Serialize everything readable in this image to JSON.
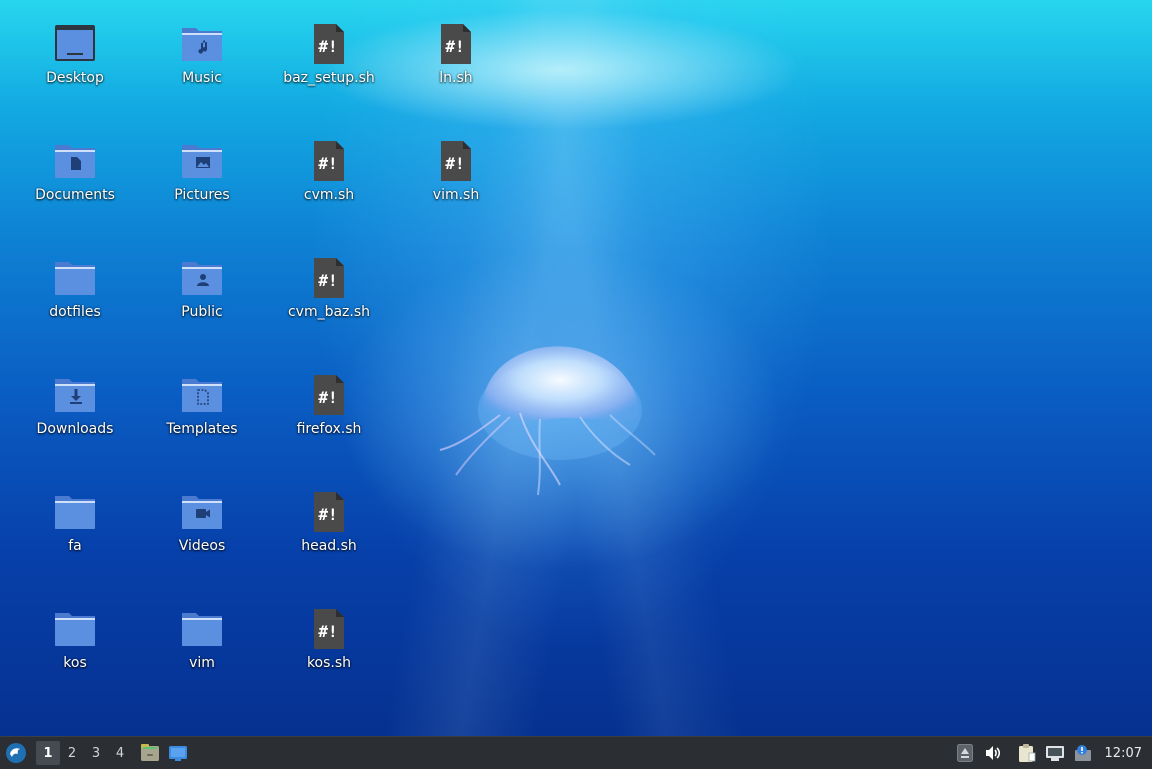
{
  "desktop": {
    "icons": [
      {
        "label": "Desktop",
        "icon": "desktop-folder-icon"
      },
      {
        "label": "Music",
        "icon": "music-folder-icon"
      },
      {
        "label": "baz_setup.sh",
        "icon": "shell-script-icon"
      },
      {
        "label": "ln.sh",
        "icon": "shell-script-icon"
      },
      {
        "label": "Documents",
        "icon": "documents-folder-icon"
      },
      {
        "label": "Pictures",
        "icon": "pictures-folder-icon"
      },
      {
        "label": "cvm.sh",
        "icon": "shell-script-icon"
      },
      {
        "label": "vim.sh",
        "icon": "shell-script-icon"
      },
      {
        "label": "dotfiles",
        "icon": "folder-icon"
      },
      {
        "label": "Public",
        "icon": "public-folder-icon"
      },
      {
        "label": "cvm_baz.sh",
        "icon": "shell-script-icon"
      },
      {
        "label": "Downloads",
        "icon": "downloads-folder-icon"
      },
      {
        "label": "Templates",
        "icon": "templates-folder-icon"
      },
      {
        "label": "firefox.sh",
        "icon": "shell-script-icon"
      },
      {
        "label": "fa",
        "icon": "folder-icon"
      },
      {
        "label": "Videos",
        "icon": "videos-folder-icon"
      },
      {
        "label": "head.sh",
        "icon": "shell-script-icon"
      },
      {
        "label": "kos",
        "icon": "folder-icon"
      },
      {
        "label": "vim",
        "icon": "folder-icon"
      },
      {
        "label": "kos.sh",
        "icon": "shell-script-icon"
      }
    ]
  },
  "taskbar": {
    "menu_icon": "whisker-menu-icon",
    "workspaces": [
      "1",
      "2",
      "3",
      "4"
    ],
    "active_workspace": "1",
    "launchers": [
      "file-manager-icon",
      "show-desktop-icon"
    ],
    "tray": [
      "eject-icon",
      "volume-icon",
      "clipboard-icon",
      "network-icon",
      "notification-icon"
    ],
    "clock": "12:07"
  },
  "colors": {
    "folder": "#5b8fe0",
    "folder_tab": "#4a7bd0",
    "script": "#4a4a4a",
    "taskbar": "#2b2f33"
  }
}
